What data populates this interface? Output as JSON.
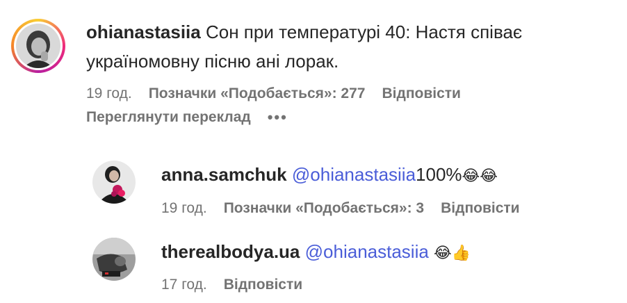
{
  "comment": {
    "username": "ohianastasiia",
    "text_line1": "Сон при температурі 40: Настя співає",
    "text_line2": "україномовну пісню ані лорак.",
    "time": "19 год.",
    "likes": "Позначки «Подобається»: 277",
    "reply": "Відповісти",
    "translate": "Переглянути переклад",
    "more": "•••"
  },
  "replies": [
    {
      "username": "anna.samchuk",
      "mention": "@ohianastasiia",
      "text": "100%",
      "emoji": "😂😂",
      "time": "19 год.",
      "likes": "Позначки «Подобається»: 3",
      "reply": "Відповісти"
    },
    {
      "username": "therealbodya.ua",
      "mention": "@ohianastasiia",
      "emoji": "😂👍",
      "time": "17 год.",
      "reply": "Відповісти"
    }
  ],
  "colors": {
    "mention": "#4a5dd8",
    "meta": "#737373",
    "text": "#262626"
  }
}
